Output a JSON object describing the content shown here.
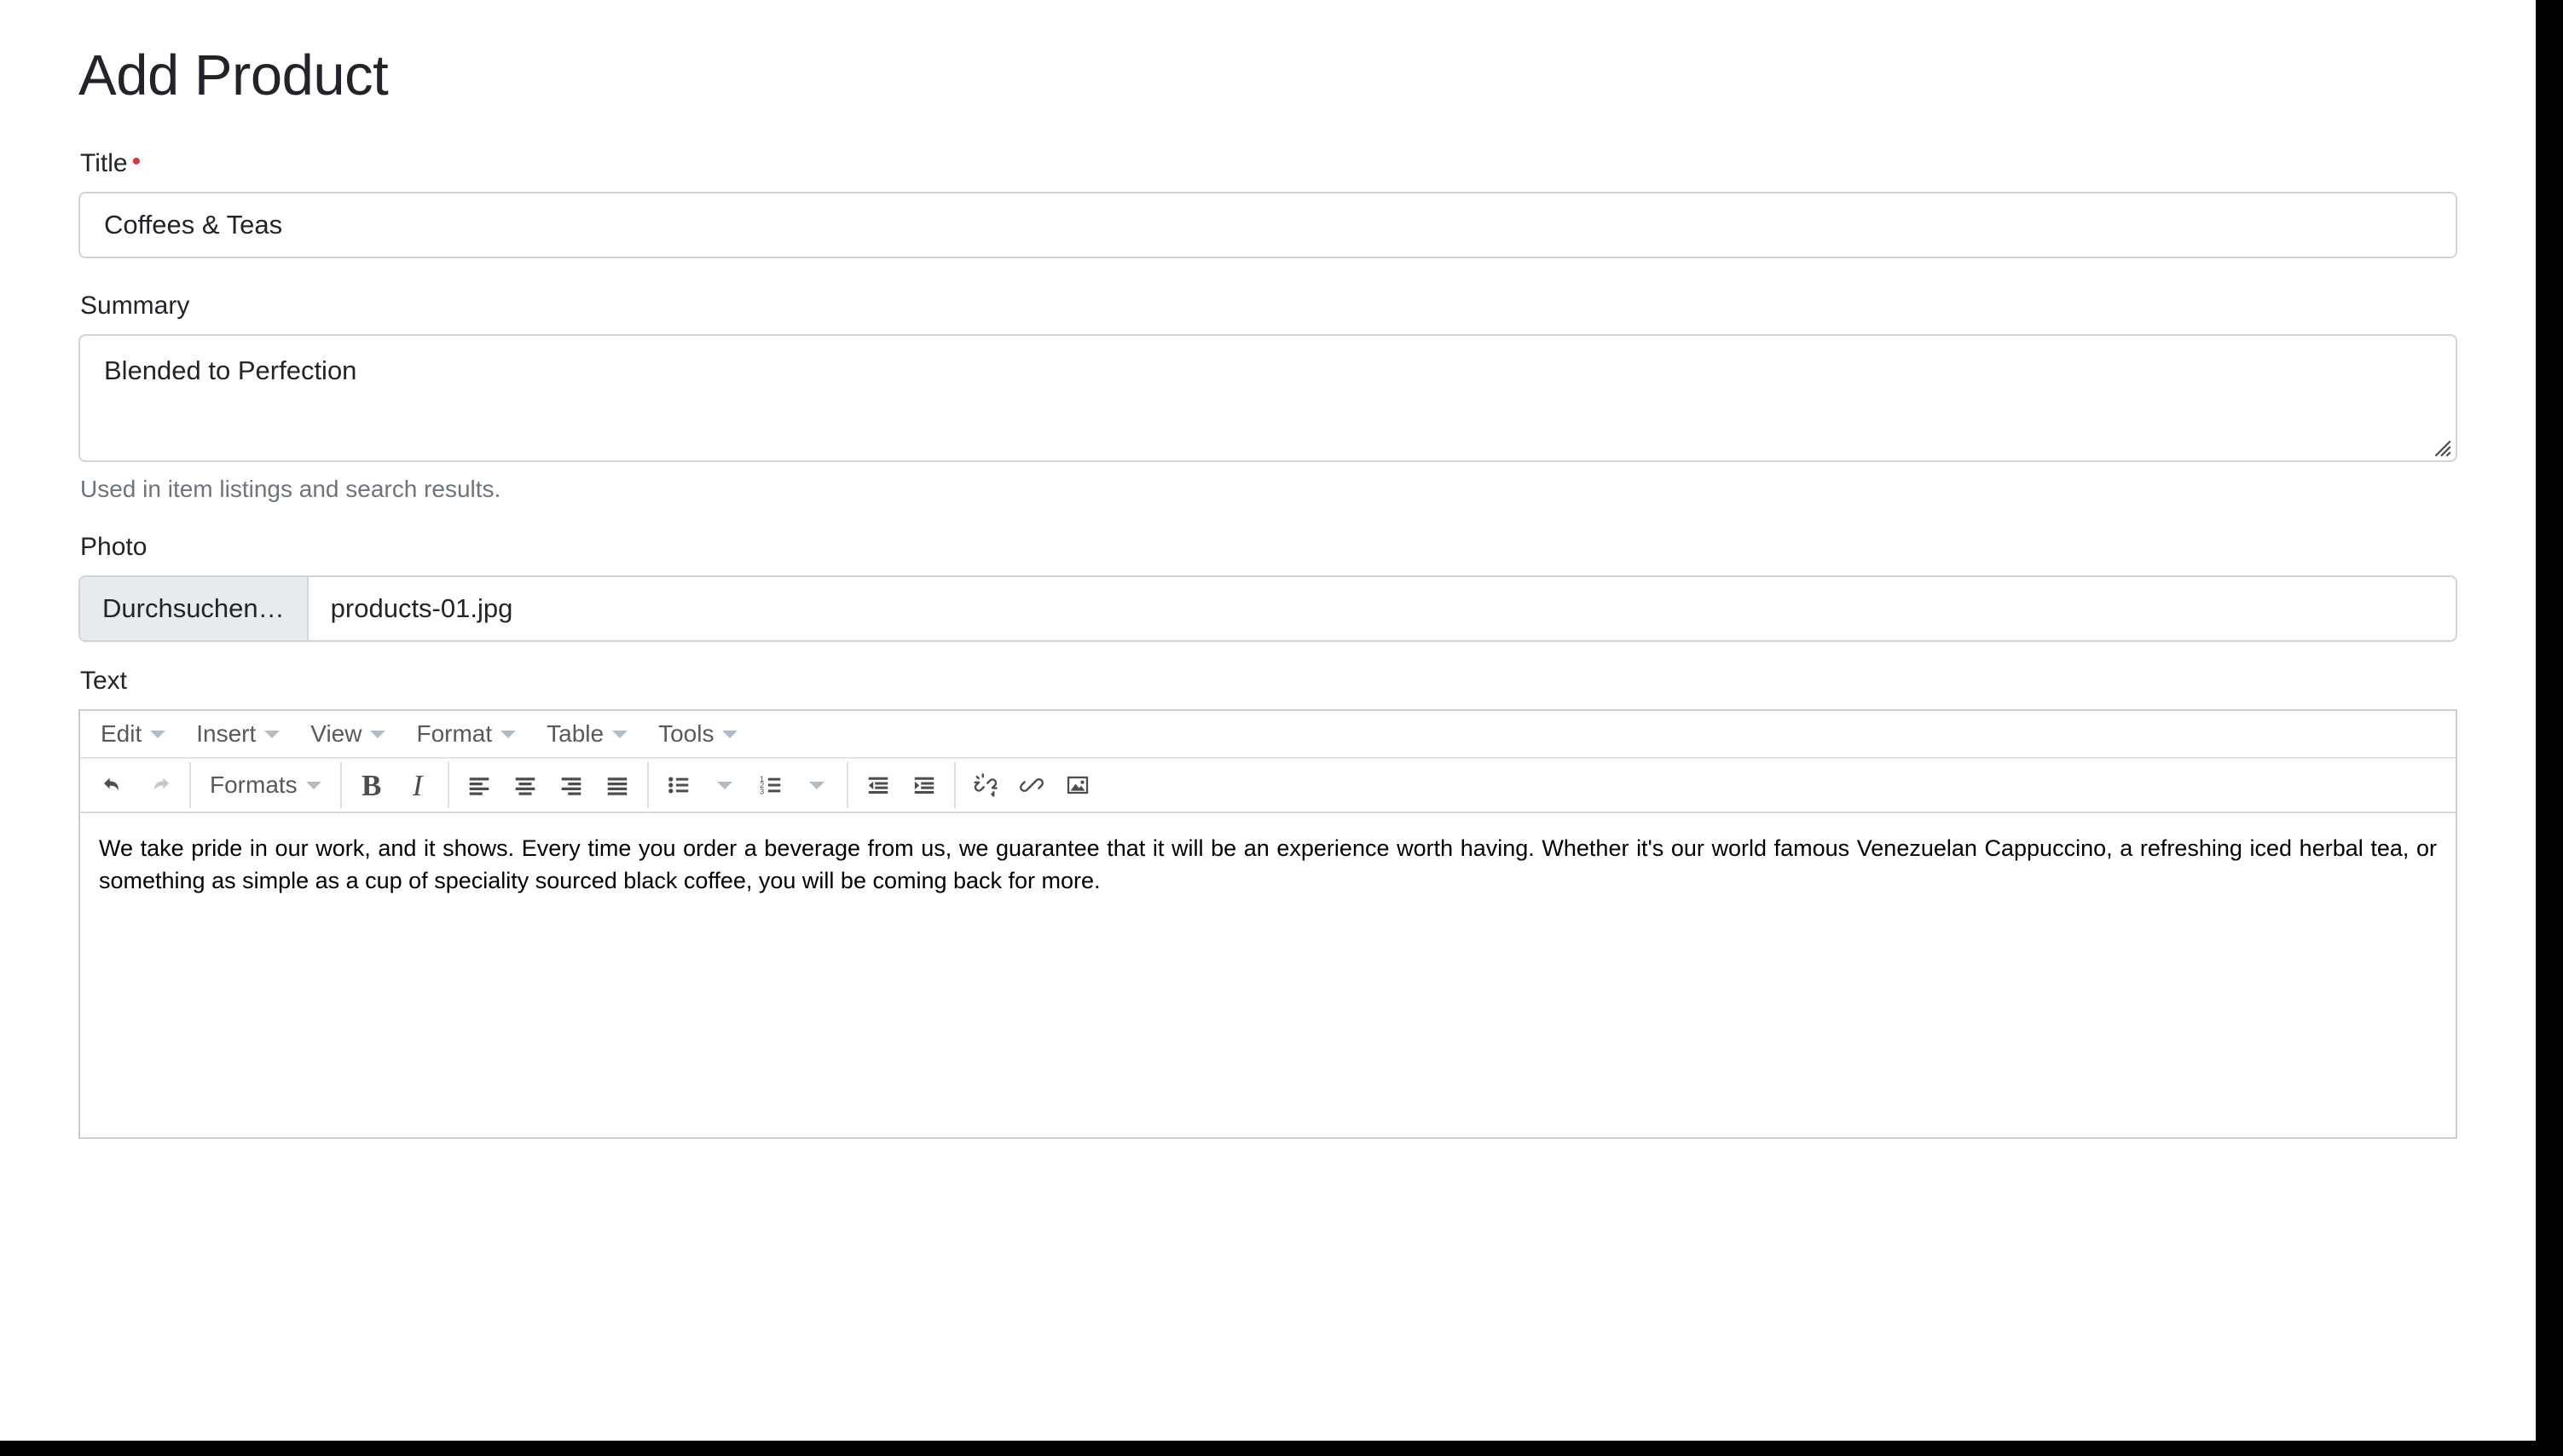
{
  "page": {
    "title": "Add Product"
  },
  "fields": {
    "title": {
      "label": "Title",
      "required_marker": "•",
      "value": "Coffees & Teas",
      "placeholder": ""
    },
    "summary": {
      "label": "Summary",
      "value": "Blended to Perfection",
      "placeholder": "",
      "help": "Used in item listings and search results."
    },
    "photo": {
      "label": "Photo",
      "browse_button": "Durchsuchen…",
      "file_name": "products-01.jpg"
    },
    "text": {
      "label": "Text"
    }
  },
  "editor": {
    "menubar": [
      {
        "label": "Edit",
        "icon": "chevron-down-icon"
      },
      {
        "label": "Insert",
        "icon": "chevron-down-icon"
      },
      {
        "label": "View",
        "icon": "chevron-down-icon"
      },
      {
        "label": "Format",
        "icon": "chevron-down-icon"
      },
      {
        "label": "Table",
        "icon": "chevron-down-icon"
      },
      {
        "label": "Tools",
        "icon": "chevron-down-icon"
      }
    ],
    "toolbar": {
      "undo": "undo-icon",
      "redo": "redo-icon",
      "formats_label": "Formats",
      "bold": "B",
      "italic": "I",
      "align_left": "align-left-icon",
      "align_center": "align-center-icon",
      "align_right": "align-right-icon",
      "align_justify": "align-justify-icon",
      "bullet_list": "bullet-list-icon",
      "numbered_list": "numbered-list-icon",
      "outdent": "outdent-icon",
      "indent": "indent-icon",
      "unlink": "unlink-icon",
      "link": "link-icon",
      "image": "image-icon"
    },
    "content": "We take pride in our work, and it shows. Every time you order a beverage from us, we guarantee that it will be an experience worth having. Whether it's our world famous Venezuelan Cappuccino, a refreshing iced herbal tea, or something as simple as a cup of speciality sourced black coffee, you will be coming back for more."
  },
  "colors": {
    "required": "#dc3545",
    "text": "#212529",
    "muted": "#6c757d",
    "border": "#ced4da",
    "button_face": "#e7ebee",
    "icon": "#4d4d4d",
    "icon_disabled": "#c8c8c8"
  }
}
